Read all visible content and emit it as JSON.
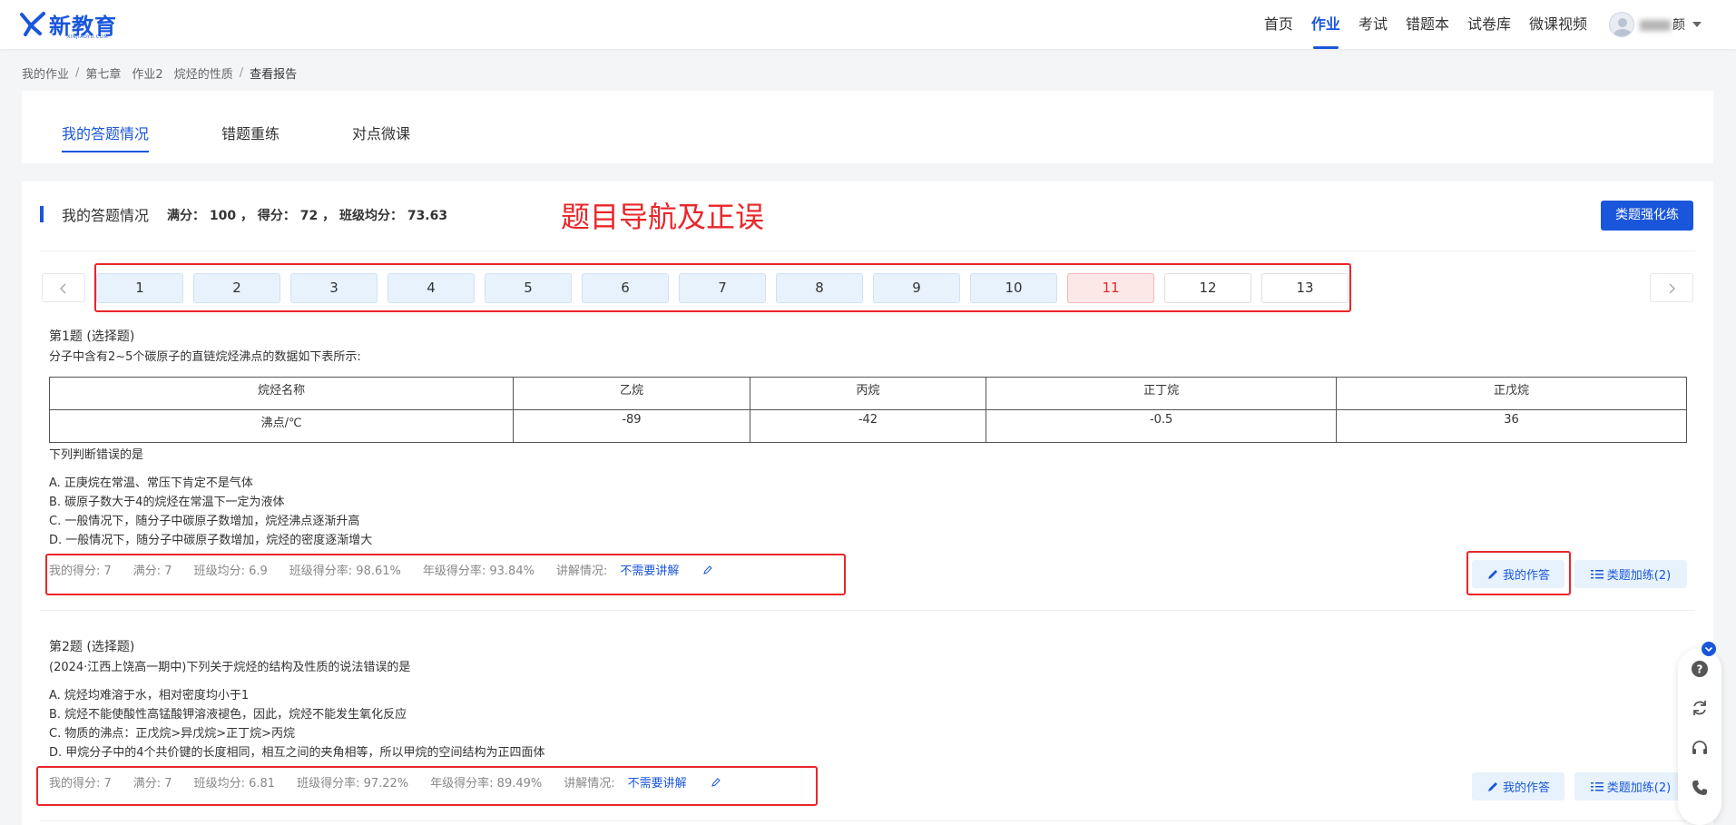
{
  "header": {
    "logo_text": "新教育",
    "logo_sub": "XINJIAOYU.COM",
    "nav": [
      "首页",
      "作业",
      "考试",
      "错题本",
      "试卷库",
      "微课视频"
    ],
    "active_nav": "作业",
    "username_suffix": "颜"
  },
  "breadcrumb": [
    "我的作业",
    "第七章",
    "作业2",
    "烷烃的性质",
    "查看报告"
  ],
  "tabs": [
    "我的答题情况",
    "错题重练",
    "对点微课"
  ],
  "section": {
    "title": "我的答题情况",
    "summary": "满分： 100 ， 得分： 72 ， 班级均分： 73.63",
    "annotation": "题目导航及正误",
    "practice_button": "类题强化练"
  },
  "question_nav": {
    "items": [
      {
        "num": "1",
        "status": "correct"
      },
      {
        "num": "2",
        "status": "correct"
      },
      {
        "num": "3",
        "status": "correct"
      },
      {
        "num": "4",
        "status": "correct"
      },
      {
        "num": "5",
        "status": "correct"
      },
      {
        "num": "6",
        "status": "correct"
      },
      {
        "num": "7",
        "status": "correct"
      },
      {
        "num": "8",
        "status": "correct"
      },
      {
        "num": "9",
        "status": "correct"
      },
      {
        "num": "10",
        "status": "correct"
      },
      {
        "num": "11",
        "status": "wrong"
      },
      {
        "num": "12",
        "status": "unanswered"
      },
      {
        "num": "13",
        "status": "unanswered"
      }
    ]
  },
  "colors": {
    "accent": "#1a56db",
    "correct_bg": "#e7f2fd",
    "wrong_bg": "#fde8e8",
    "wrong_text": "#e8262a",
    "annotation_red": "#e8262a"
  },
  "q1": {
    "title": "第1题 (选择题)",
    "stem": "分子中含有2~5个碳原子的直链烷烃沸点的数据如下表所示:",
    "table": {
      "header": [
        "烷烃名称",
        "乙烷",
        "丙烷",
        "正丁烷",
        "正戊烷"
      ],
      "row": [
        "沸点/℃",
        "-89",
        "-42",
        "-0.5",
        "36"
      ]
    },
    "question": "下列判断错误的是",
    "options": [
      "A. 正庚烷在常温、常压下肯定不是气体",
      "B. 碳原子数大于4的烷烃在常温下一定为液体",
      "C. 一般情况下，随分子中碳原子数增加，烷烃沸点逐渐升高",
      "D. 一般情况下，随分子中碳原子数增加，烷烃的密度逐渐增大"
    ],
    "stats": {
      "my_score": "我的得分:  7",
      "full": "满分:  7",
      "class_avg": "班级均分:  6.9",
      "class_rate": "班级得分率:  98.61%",
      "grade_rate": "年级得分率:  93.84%",
      "explain_label": "讲解情况:",
      "explain_value": "不需要讲解"
    },
    "my_answer_button": "我的作答",
    "similar_button": "类题加练(2)"
  },
  "q2": {
    "title": "第2题 (选择题)",
    "stem": "(2024·江西上饶高一期中)下列关于烷烃的结构及性质的说法错误的是",
    "options": [
      "A. 烷烃均难溶于水，相对密度均小于1",
      "B. 烷烃不能使酸性高锰酸钾溶液褪色，因此，烷烃不能发生氧化反应",
      "C. 物质的沸点：正戊烷>异戊烷>正丁烷>丙烷",
      "D. 甲烷分子中的4个共价键的长度相同，相互之间的夹角相等，所以甲烷的空间结构为正四面体"
    ],
    "stats": {
      "my_score": "我的得分:  7",
      "full": "满分:  7",
      "class_avg": "班级均分:  6.81",
      "class_rate": "班级得分率:  97.22%",
      "grade_rate": "年级得分率:  89.49%",
      "explain_label": "讲解情况:",
      "explain_value": "不需要讲解"
    },
    "my_answer_button": "我的作答",
    "similar_button": "类题加练(2)"
  },
  "float_tools": [
    "help-icon",
    "refresh-icon",
    "headset-icon",
    "phone-icon"
  ]
}
